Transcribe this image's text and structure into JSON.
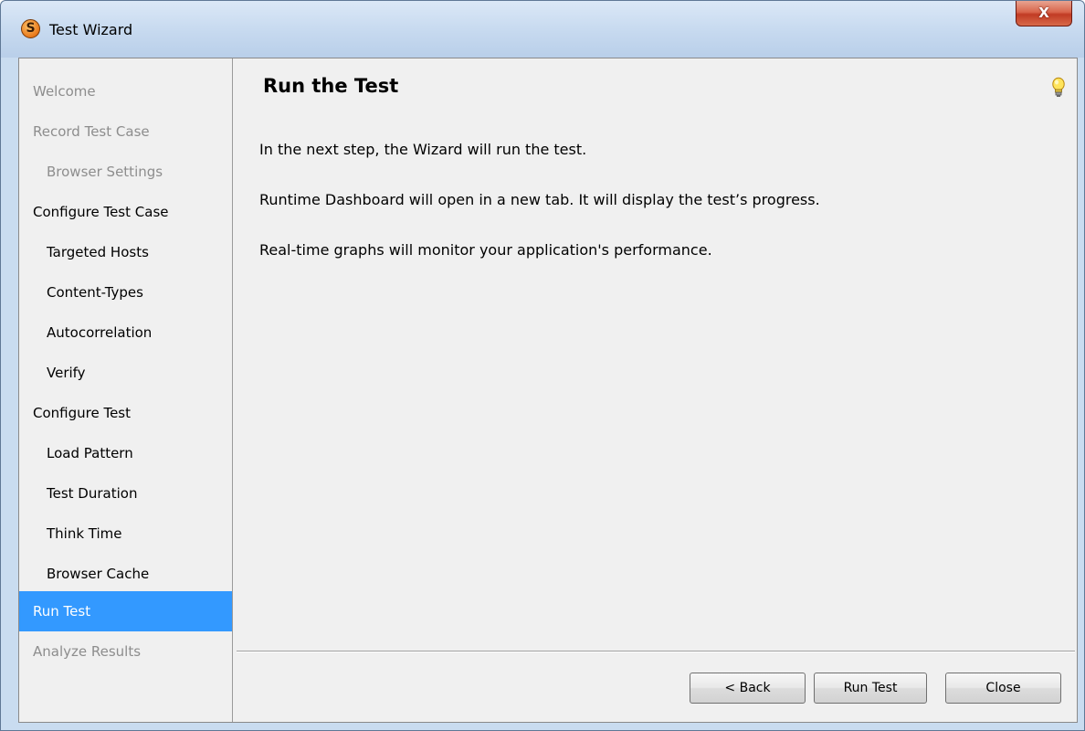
{
  "window": {
    "title": "Test Wizard",
    "app_icon_letter": "S",
    "close_glyph": "X"
  },
  "sidebar": {
    "items": [
      {
        "label": "Welcome",
        "level": 1,
        "state": "disabled"
      },
      {
        "label": "Record Test Case",
        "level": 1,
        "state": "disabled"
      },
      {
        "label": "Browser Settings",
        "level": 2,
        "state": "disabled"
      },
      {
        "label": "Configure Test Case",
        "level": 1,
        "state": "normal"
      },
      {
        "label": "Targeted Hosts",
        "level": 2,
        "state": "normal"
      },
      {
        "label": "Content-Types",
        "level": 2,
        "state": "normal"
      },
      {
        "label": "Autocorrelation",
        "level": 2,
        "state": "normal"
      },
      {
        "label": "Verify",
        "level": 2,
        "state": "normal"
      },
      {
        "label": "Configure Test",
        "level": 1,
        "state": "normal"
      },
      {
        "label": "Load Pattern",
        "level": 2,
        "state": "normal"
      },
      {
        "label": "Test Duration",
        "level": 2,
        "state": "normal"
      },
      {
        "label": "Think Time",
        "level": 2,
        "state": "normal"
      },
      {
        "label": "Browser Cache",
        "level": 2,
        "state": "normal"
      },
      {
        "label": "Run Test",
        "level": 1,
        "state": "selected"
      },
      {
        "label": "Analyze Results",
        "level": 1,
        "state": "disabled"
      }
    ]
  },
  "main": {
    "heading": "Run the Test",
    "hint_icon": "lightbulb-icon",
    "paragraphs": [
      "In the next step, the Wizard will run the test.",
      "Runtime Dashboard will open in a new tab. It will display the test’s progress.",
      "Real-time graphs will monitor your application's performance."
    ]
  },
  "buttons": {
    "back": "< Back",
    "run": "Run Test",
    "close": "Close"
  },
  "colors": {
    "selection": "#3399ff",
    "disabled_text": "#8d8d8d",
    "panel_bg": "#f0f0f0",
    "titlebar": "#c6d9ef",
    "close_button": "#c13b24"
  }
}
